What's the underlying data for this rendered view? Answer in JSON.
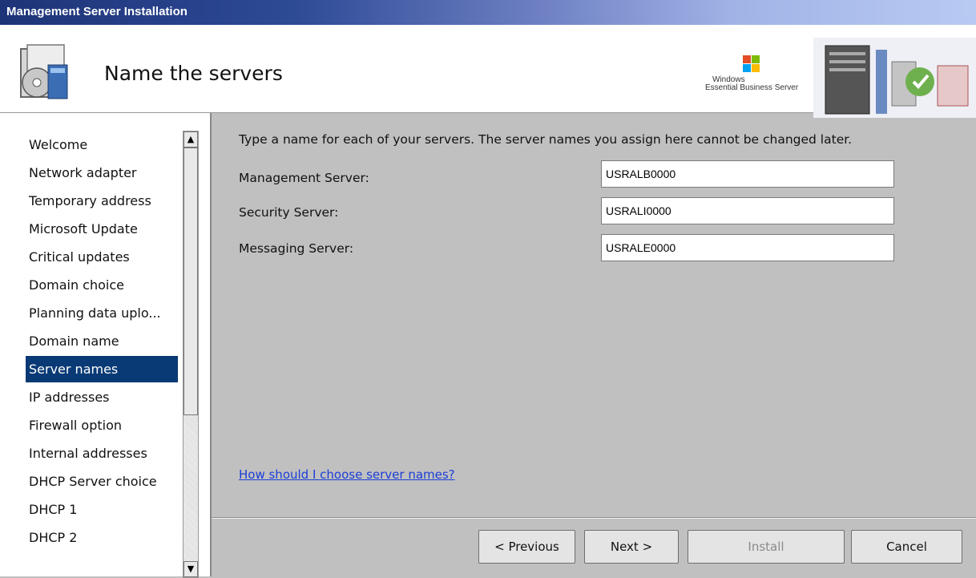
{
  "window": {
    "title": "Management Server Installation"
  },
  "header": {
    "title": "Name the servers",
    "brand_line1": "Windows",
    "brand_line2": "Essential Business Server"
  },
  "sidebar": {
    "items": [
      {
        "label": "Welcome",
        "active": false
      },
      {
        "label": "Network adapter",
        "active": false
      },
      {
        "label": "Temporary address",
        "active": false
      },
      {
        "label": "Microsoft Update",
        "active": false
      },
      {
        "label": "Critical updates",
        "active": false
      },
      {
        "label": "Domain choice",
        "active": false
      },
      {
        "label": "Planning data uplo...",
        "active": false
      },
      {
        "label": "Domain name",
        "active": false
      },
      {
        "label": "Server names",
        "active": true
      },
      {
        "label": "IP addresses",
        "active": false
      },
      {
        "label": "Firewall option",
        "active": false
      },
      {
        "label": "Internal addresses",
        "active": false
      },
      {
        "label": "DHCP Server choice",
        "active": false
      },
      {
        "label": "DHCP 1",
        "active": false
      },
      {
        "label": "DHCP 2",
        "active": false
      }
    ]
  },
  "main": {
    "instruction": "Type a name for each of your servers. The server names you assign here cannot be changed later.",
    "fields": {
      "management": {
        "label": "Management Server:",
        "value": "USRALB0000"
      },
      "security": {
        "label": "Security Server:",
        "value": "USRALI0000"
      },
      "messaging": {
        "label": "Messaging Server:",
        "value": "USRALE0000"
      }
    },
    "help_link": "How should I choose server names?"
  },
  "footer": {
    "previous": "< Previous",
    "next": "Next >",
    "install": "Install",
    "cancel": "Cancel"
  },
  "colors": {
    "selection": "#0a3a75",
    "link": "#1a3dd6",
    "titlebar": "#1e3478"
  }
}
